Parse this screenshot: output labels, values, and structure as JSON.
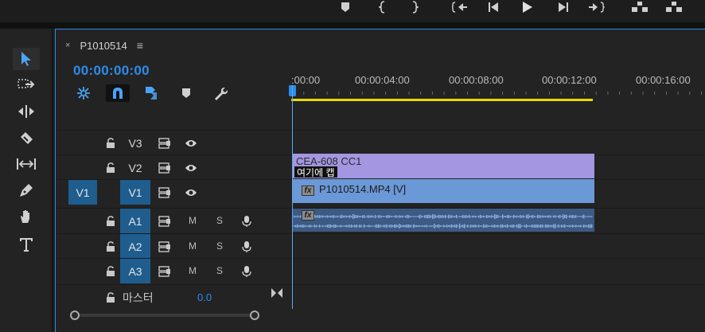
{
  "timeline": {
    "sequence_tab": "P1010514",
    "close_glyph": "×",
    "menu_glyph": "≡",
    "timecode": "00:00:00:00",
    "ruler_labels": [
      ":00:00",
      "00:00:04:00",
      "00:00:08:00",
      "00:00:12:00",
      "00:00:16:00"
    ]
  },
  "tracks": {
    "video": [
      {
        "name": "V3",
        "source": "",
        "target_on": false
      },
      {
        "name": "V2",
        "source": "",
        "target_on": false
      },
      {
        "name": "V1",
        "source": "V1",
        "target_on": true
      }
    ],
    "audio": [
      {
        "name": "A1",
        "mute": "M",
        "solo": "S"
      },
      {
        "name": "A2",
        "mute": "M",
        "solo": "S"
      },
      {
        "name": "A3",
        "mute": "M",
        "solo": "S"
      }
    ],
    "master": {
      "label": "마스터",
      "value": "0.0"
    }
  },
  "clips": {
    "caption": {
      "name": "CEA-608 CC1",
      "text": "여기에 캡"
    },
    "video": {
      "name": "P1010514.MP4 [V]",
      "fx": "fx"
    },
    "audio": {
      "fx": "fx"
    }
  },
  "colors": {
    "accent": "#2d8ceb",
    "caption_clip": "#a496e0",
    "video_clip": "#6b98d6",
    "audio_clip": "#3c5a84",
    "work_area": "#e6d900",
    "track_target": "#1f5d8f"
  },
  "icons": {
    "transport": [
      "add-marker-icon",
      "mark-in-icon",
      "mark-out-icon",
      "go-to-in-icon",
      "step-back-icon",
      "play-icon",
      "step-forward-icon",
      "go-to-out-icon",
      "lift-icon",
      "extract-icon"
    ],
    "tools": [
      "selection-tool-icon",
      "track-select-tool-icon",
      "ripple-edit-tool-icon",
      "razor-tool-icon",
      "slip-tool-icon",
      "pen-tool-icon",
      "hand-tool-icon",
      "type-tool-icon"
    ],
    "timeline_tools": [
      "nest-toggle-icon",
      "snap-icon",
      "linked-selection-icon",
      "add-marker-icon",
      "settings-wrench-icon"
    ]
  }
}
